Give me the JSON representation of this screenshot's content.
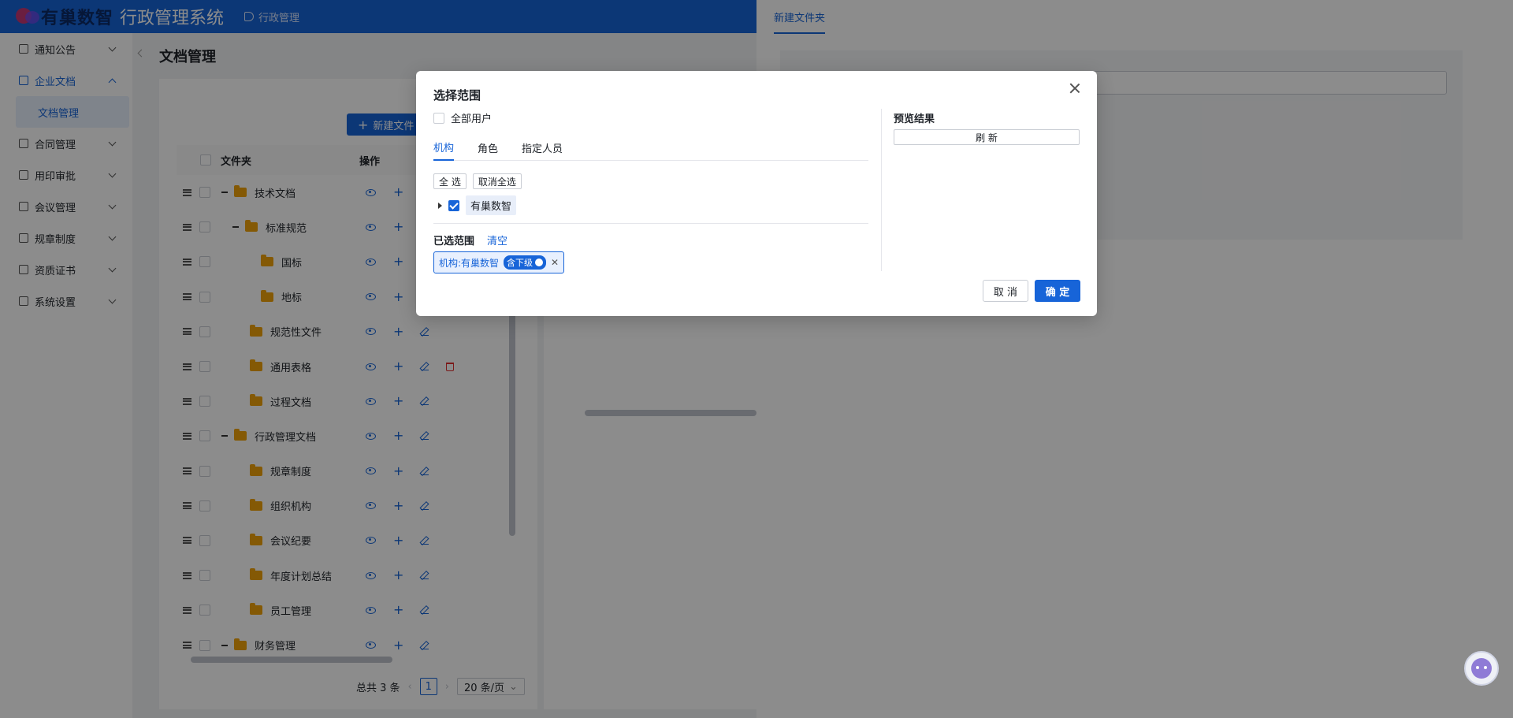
{
  "header": {
    "logo_text": "有巢数智",
    "system_title": "行政管理系统",
    "breadcrumb": "行政管理"
  },
  "sidebar": {
    "items": [
      {
        "label": "通知公告",
        "icon": "megaphone-icon"
      },
      {
        "label": "企业文档",
        "icon": "document-icon",
        "expanded": true
      },
      {
        "label": "合同管理",
        "icon": "contract-icon"
      },
      {
        "label": "用印审批",
        "icon": "seal-icon"
      },
      {
        "label": "会议管理",
        "icon": "meeting-icon"
      },
      {
        "label": "规章制度",
        "icon": "rules-icon"
      },
      {
        "label": "资质证书",
        "icon": "certificate-icon"
      },
      {
        "label": "系统设置",
        "icon": "gear-icon"
      }
    ],
    "sub_item": "文档管理"
  },
  "main": {
    "page_title": "文档管理",
    "new_folder_button": "新建文件",
    "table": {
      "columns": [
        "文件夹",
        "操作"
      ],
      "rows": [
        {
          "name": "技术文档",
          "level": 0,
          "expanded": true
        },
        {
          "name": "标准规范",
          "level": 1,
          "expanded": true
        },
        {
          "name": "国标",
          "level": 2
        },
        {
          "name": "地标",
          "level": 2
        },
        {
          "name": "规范性文件",
          "level": 1
        },
        {
          "name": "通用表格",
          "level": 1,
          "deletable": true
        },
        {
          "name": "过程文档",
          "level": 1
        },
        {
          "name": "行政管理文档",
          "level": 0,
          "expanded": true
        },
        {
          "name": "规章制度",
          "level": 1
        },
        {
          "name": "组织机构",
          "level": 1
        },
        {
          "name": "会议纪要",
          "level": 1
        },
        {
          "name": "年度计划总结",
          "level": 1
        },
        {
          "name": "员工管理",
          "level": 1
        },
        {
          "name": "财务管理",
          "level": 0,
          "expanded": true
        }
      ]
    },
    "pagination": {
      "total": "总共 3 条",
      "current_page": "1",
      "page_size": "20 条/页"
    }
  },
  "drawer": {
    "tab": "新建文件夹"
  },
  "modal": {
    "title": "选择范围",
    "all_users_label": "全部用户",
    "tabs": [
      "机构",
      "角色",
      "指定人员"
    ],
    "active_tab": 0,
    "select_all": "全 选",
    "deselect_all": "取消全选",
    "tree_node": "有巢数智",
    "selected_label": "已选范围",
    "clear_label": "清空",
    "selected_tag": {
      "text": "机构:有巢数智",
      "badge": "含下级"
    },
    "preview_title": "预览结果",
    "refresh_button": "刷 新",
    "cancel_button": "取 消",
    "confirm_button": "确 定"
  },
  "colors": {
    "primary": "#1764d8",
    "header_bg": "#1764d8",
    "danger": "#e03131",
    "folder": "#f0a30a"
  }
}
